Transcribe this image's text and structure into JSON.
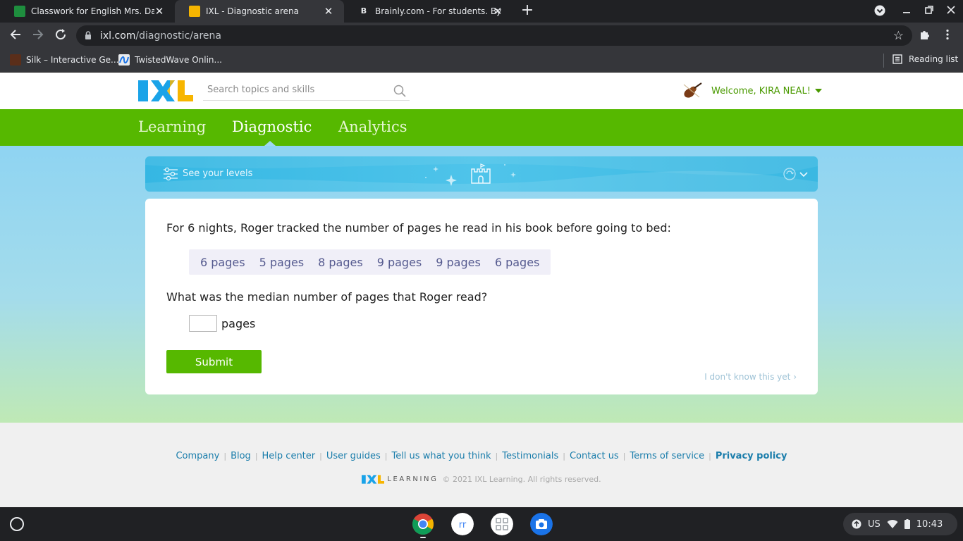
{
  "browser": {
    "tabs": [
      {
        "title": "Classwork for English Mrs. Darden",
        "favicon_color": "#1e8e3e"
      },
      {
        "title": "IXL - Diagnostic arena",
        "favicon_color": "#f4b400"
      },
      {
        "title": "Brainly.com - For students. By students.",
        "favicon_color": "#202124"
      }
    ],
    "url_host": "ixl.com",
    "url_path": "/diagnostic/arena",
    "bookmarks": [
      {
        "label": "Silk – Interactive Ge..."
      },
      {
        "label": "TwistedWave Onlin..."
      }
    ],
    "reading_list": "Reading list"
  },
  "header": {
    "search_placeholder": "Search topics and skills",
    "welcome": "Welcome, KIRA NEAL!"
  },
  "nav": {
    "items": [
      {
        "label": "Learning"
      },
      {
        "label": "Diagnostic"
      },
      {
        "label": "Analytics"
      }
    ],
    "active": "Diagnostic"
  },
  "levels_bar": {
    "label": "See your levels"
  },
  "question": {
    "prompt": "For 6 nights, Roger tracked the number of pages he read in his book before going to bed:",
    "values": [
      "6 pages",
      "5 pages",
      "8 pages",
      "9 pages",
      "9 pages",
      "6 pages"
    ],
    "ask": "What was the median number of pages that Roger read?",
    "answer_value": "",
    "unit": "pages",
    "submit_label": "Submit",
    "dont_know": "I don't know this yet"
  },
  "footer": {
    "links": [
      {
        "label": "Company"
      },
      {
        "label": "Blog"
      },
      {
        "label": "Help center"
      },
      {
        "label": "User guides"
      },
      {
        "label": "Tell us what you think"
      },
      {
        "label": "Testimonials"
      },
      {
        "label": "Contact us"
      },
      {
        "label": "Terms of service"
      },
      {
        "label": "Privacy policy"
      }
    ],
    "brand_word": "LEARNING",
    "copyright": "© 2021 IXL Learning. All rights reserved."
  },
  "shelf": {
    "locale": "US",
    "time": "10:43"
  },
  "colors": {
    "ixl_green": "#56b800",
    "link_blue": "#1a7dab",
    "data_text": "#555a8f"
  }
}
